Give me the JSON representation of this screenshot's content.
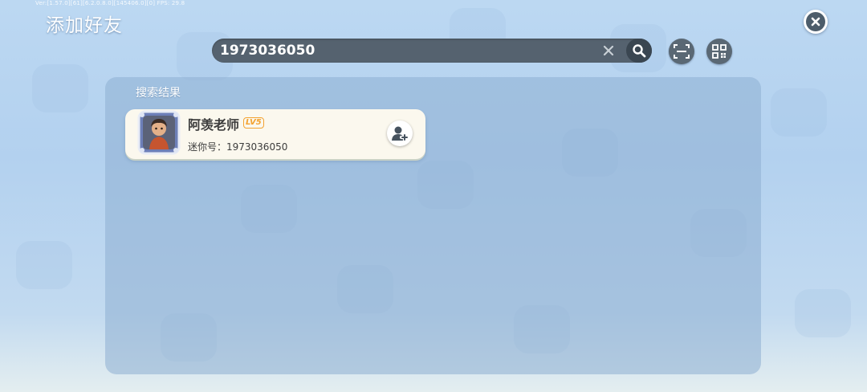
{
  "header": {
    "version": "Ver:[1.57.0][61][6.2.0.8.0][145406.0][0] FPS: 29.8",
    "title": "添加好友"
  },
  "search": {
    "value": "1973036050"
  },
  "results": {
    "section_label": "搜索结果",
    "items": [
      {
        "nickname": "阿羡老师",
        "level": "LV5",
        "mini_id": "迷你号：1973036050"
      }
    ]
  },
  "icons": {
    "close": "close-icon",
    "clear": "clear-icon",
    "search": "search-icon",
    "scan": "scan-icon",
    "qr": "qr-code-icon",
    "add_friend": "add-friend-icon"
  },
  "colors": {
    "title_text": "#ffffff",
    "search_bar": "#55626f",
    "level_badge": "#f3a332",
    "card_bg": "#fbf8ee"
  }
}
